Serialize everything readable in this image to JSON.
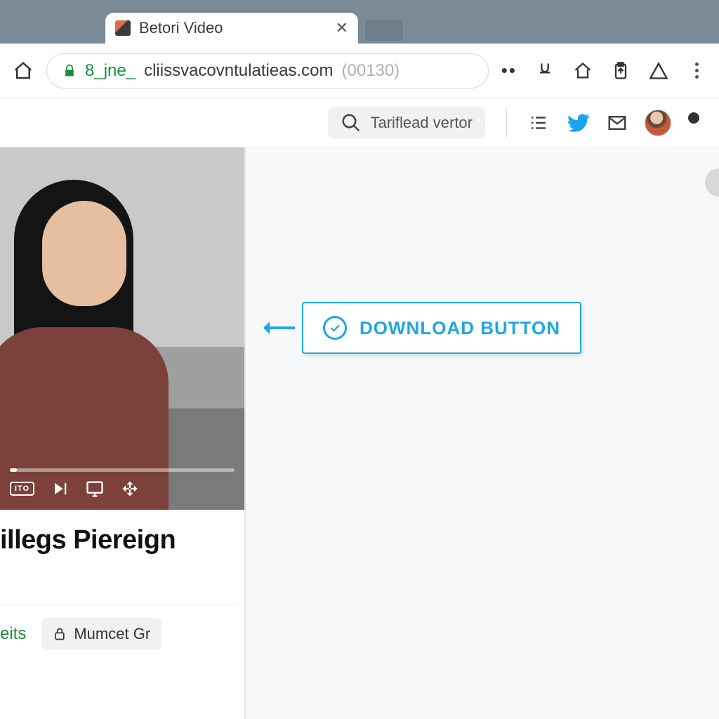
{
  "browser": {
    "tab_title": "Betori Video",
    "url_prefix": "8_jne_",
    "url_host": "cliissvacovntulatieas.com",
    "url_suffix": " (00130)"
  },
  "header": {
    "search_placeholder": "Tariflead vertor"
  },
  "video": {
    "badge": "ITO",
    "title": "illegs Piereign"
  },
  "below": {
    "link_text": "eits",
    "pill_text": "Mumcet Gr"
  },
  "callout": {
    "label": "DOWNLOAD BUTTON"
  }
}
